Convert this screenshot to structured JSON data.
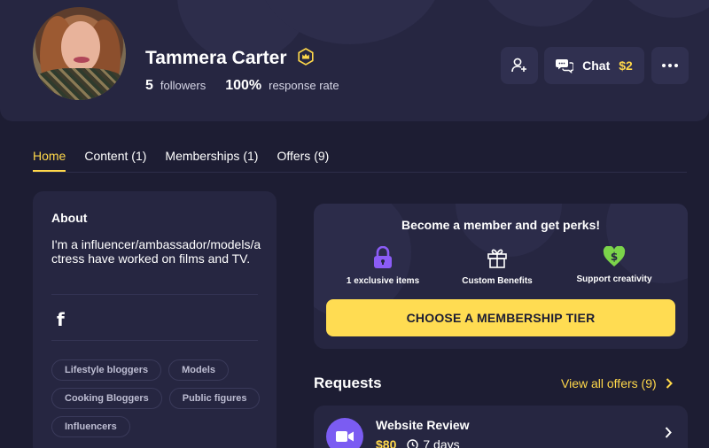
{
  "profile": {
    "name": "Tammera Carter",
    "followers_count": "5",
    "followers_label": "followers",
    "response_rate": "100%",
    "response_rate_label": "response rate"
  },
  "actions": {
    "chat_label": "Chat",
    "chat_price": "$2"
  },
  "tabs": [
    {
      "label": "Home",
      "active": true
    },
    {
      "label": "Content (1)",
      "active": false
    },
    {
      "label": "Memberships (1)",
      "active": false
    },
    {
      "label": "Offers (9)",
      "active": false
    }
  ],
  "about": {
    "title": "About",
    "bio": "I'm a influencer/ambassador/models/actress have worked on films and TV.",
    "social_icon": "facebook-icon",
    "tags": [
      "Lifestyle bloggers",
      "Models",
      "Cooking Bloggers",
      "Public figures",
      "Influencers"
    ]
  },
  "membership": {
    "title": "Become a member and get perks!",
    "perks": [
      {
        "label": "1 exclusive items",
        "icon": "lock-icon",
        "color": "#8b5cf6"
      },
      {
        "label": "Custom Benefits",
        "icon": "gift-icon",
        "color": "#ffffff"
      },
      {
        "label": "Support creativity",
        "icon": "heart-dollar-icon",
        "color": "#7bd44a"
      }
    ],
    "cta_label": "CHOOSE A MEMBERSHIP TIER"
  },
  "requests": {
    "title": "Requests",
    "view_all_label": "View all offers (9)",
    "items": [
      {
        "name": "Website Review",
        "price": "$80",
        "duration": "7 days",
        "icon": "video-camera-icon"
      }
    ]
  },
  "colors": {
    "background": "#1d1d33",
    "card": "#262641",
    "accent": "#ffd84a",
    "purple": "#7b5cf2"
  }
}
